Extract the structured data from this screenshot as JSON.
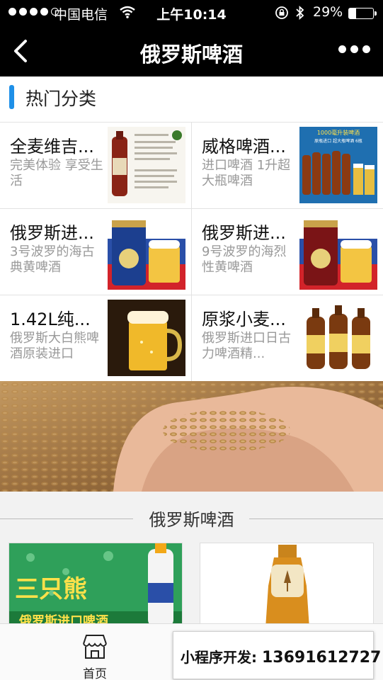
{
  "status_bar": {
    "carrier": "中国电信",
    "time": "上午10:14",
    "battery": "29%",
    "battery_level": 0.29
  },
  "nav": {
    "title": "俄罗斯啤酒"
  },
  "section": {
    "title": "热门分类"
  },
  "products": [
    {
      "name": "全麦维吉...",
      "desc": "完美体验 享受生活"
    },
    {
      "name": "威格啤酒...",
      "desc": "进口啤酒 1升超大瓶啤酒"
    },
    {
      "name": "俄罗斯进...",
      "desc": "3号波罗的海古典黄啤酒"
    },
    {
      "name": "俄罗斯进...",
      "desc": "9号波罗的海烈性黄啤酒"
    },
    {
      "name": "1.42L纯...",
      "desc": "俄罗斯大白熊啤酒原装进口"
    },
    {
      "name": "原浆小麦...",
      "desc": "俄罗斯进口日古力啤酒精..."
    }
  ],
  "thumb_text": {
    "ad_top": "1000毫升装啤酒",
    "ad_sub": "原瓶进口 超大瓶啤酒 6瓶"
  },
  "divider": {
    "title": "俄罗斯啤酒"
  },
  "big_cards": {
    "left_text": "三只熊",
    "left_sub": "俄罗斯进口啤酒"
  },
  "tab_bar": {
    "home_label": "首页"
  },
  "promo": {
    "label": "小程序开发:",
    "phone": "13691612727"
  },
  "colors": {
    "accent": "#1e90e8",
    "bar": "#000000"
  }
}
